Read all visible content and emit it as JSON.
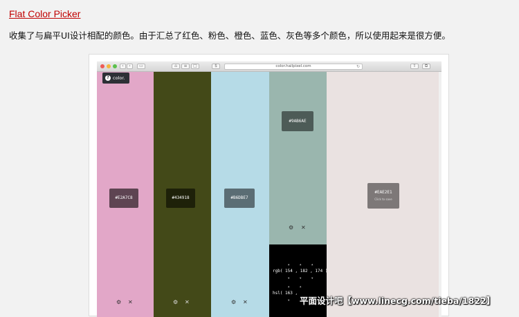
{
  "article": {
    "title": "Flat Color Picker",
    "description": "收集了与扁平UI设计相配的颜色。由于汇总了红色、粉色、橙色、蓝色、灰色等多个颜色，所以使用起来是很方便。"
  },
  "browser": {
    "url": "color.hailpixel.com",
    "traffic_lights": [
      "#ee5b56",
      "#f4b73d",
      "#5cc14d"
    ]
  },
  "app": {
    "logo_text": "color."
  },
  "columns": [
    {
      "hex": "#E2A7C8",
      "bg": "#e2a7c8",
      "label": "#E2A7C8"
    },
    {
      "hex": "#434918",
      "bg": "#434918",
      "label": "#434918"
    },
    {
      "hex": "#B6DBE7",
      "bg": "#b6dbe7",
      "label": "#B6DBE7"
    },
    {
      "hex": "#9AB6AE",
      "bg": "#9ab6ae",
      "label": "#9AB6AE"
    },
    {
      "hex": "#EAE2E1",
      "bg": "#eae2e1",
      "label": "#EAE2E1",
      "sub": "Click to save"
    }
  ],
  "controls": {
    "gear": "⚙",
    "close": "✕"
  },
  "picker": {
    "rgb": "rgb( 154 , 182 , 174 )",
    "hsl_prefix": "hsl( 163 ,"
  },
  "watermark": "平面设计吧【www.linecg.com/tieba/1822】"
}
